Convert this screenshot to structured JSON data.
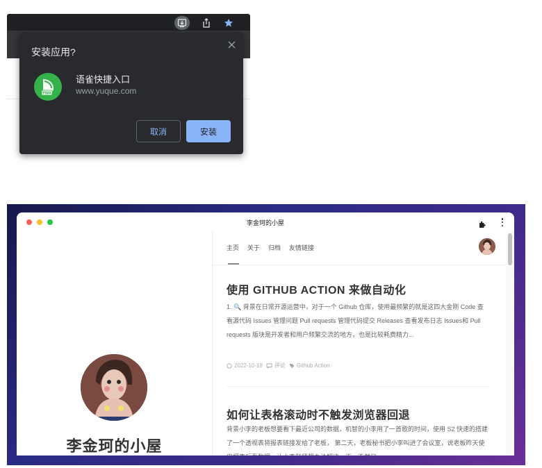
{
  "dialog": {
    "title": "安装应用?",
    "app_name": "语雀快捷入口",
    "app_url": "www.yuque.com",
    "app_icon_badge": "PWA",
    "cancel_label": "取消",
    "install_label": "安装"
  },
  "toolbar": {
    "icons": [
      "install-icon",
      "share-icon",
      "star-icon"
    ],
    "star_color": "#8ab4f8"
  },
  "window": {
    "title": "李金珂的小屋"
  },
  "nav": {
    "items": [
      {
        "label": "主页"
      },
      {
        "label": "关于"
      },
      {
        "label": "归档"
      },
      {
        "label": "友情链接"
      }
    ]
  },
  "profile": {
    "site_name": "李金珂的小屋"
  },
  "posts": [
    {
      "title": "使用 GITHUB ACTION 来做自动化",
      "excerpt": "1. 🔍 背景在日常开源运营中，对于一个 Github 仓库，使用最频繁的就是这四大金刚 Code 查看源代码 Issues 管理问题 Pull requests 管理代码提交 Releases 查看发布日志 Issues和 Pull requests 版块是开发者和用户频繁交流的地方，也是比较耗费精力...",
      "date": "2022-10-19",
      "comments": "评论",
      "tag": "Github Action"
    },
    {
      "title": "如何让表格滚动时不触发浏览器回退",
      "excerpt": "背景小李的老板想要看下最近公司的数据，机智的小李用了一首歌的时间，使用 S2 快速的搭建了一个透视表将报表链接发给了老板， 第二天，老板秘书把小李叫进了会议室，说老板昨天使用报表后看数据，让小李赶紧想办法解决一下，不然只"
    }
  ],
  "colors": {
    "accent_blue": "#8ab4f8",
    "dialog_bg": "#292a2d",
    "pwa_green": "#36b24a"
  }
}
